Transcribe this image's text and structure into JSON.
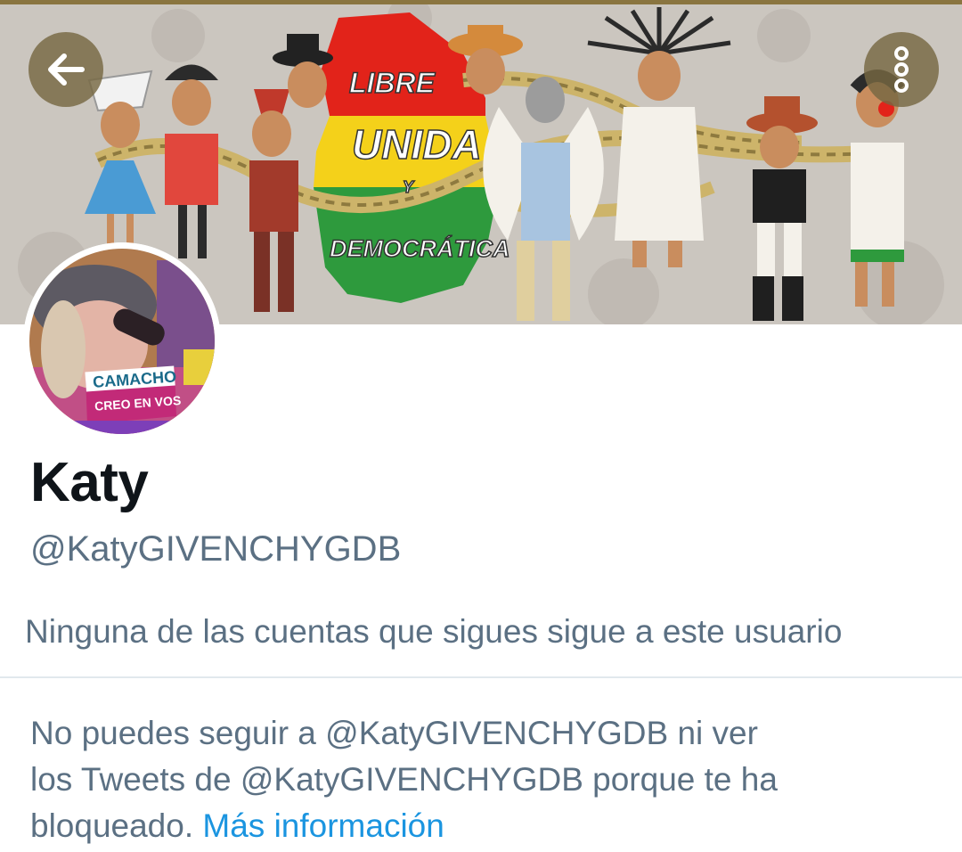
{
  "header": {
    "back_icon": "arrow-left-icon",
    "more_icon": "more-vertical-icon"
  },
  "banner": {
    "line1": "LIBRE",
    "line2": "UNIDA",
    "line3": "Y",
    "line4": "DEMOCRÁTICA",
    "colors": {
      "red": "#e2231a",
      "yellow": "#f4d11a",
      "green": "#2e9a3d"
    }
  },
  "avatar": {
    "badge_title": "CAMACHO",
    "badge_subtitle": "CREO EN VOS"
  },
  "profile": {
    "name": "Katy",
    "handle": "@KatyGIVENCHYGDB",
    "follow_note": "Ninguna de las cuentas que sigues sigue a este usuario"
  },
  "blocked": {
    "line1": "No puedes seguir a @KatyGIVENCHYGDB ni ver",
    "line2": "los Tweets de @KatyGIVENCHYGDB porque te ha",
    "line3_prefix": "bloqueado.",
    "link": "Más información"
  },
  "theme": {
    "text_primary": "#0f1419",
    "text_secondary": "#5b7083",
    "link": "#1b95e0"
  }
}
